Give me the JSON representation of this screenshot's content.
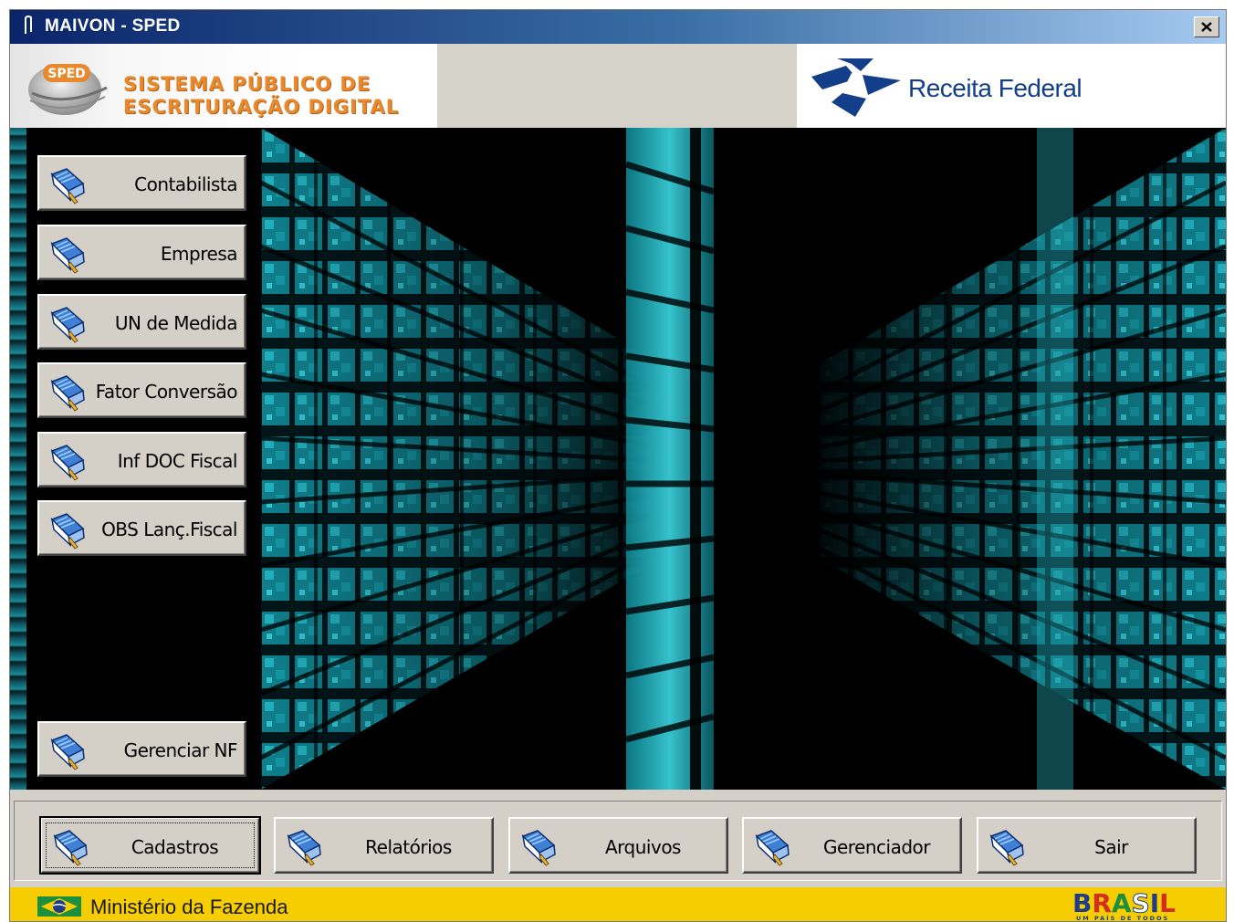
{
  "window": {
    "title": "MAIVON - SPED",
    "close_icon": "close-icon"
  },
  "header": {
    "sped_badge": "SPED",
    "sped_line1": "SISTEMA PÚBLICO DE",
    "sped_line2": "ESCRITURAÇÃO DIGITAL",
    "receita_text": "Receita Federal"
  },
  "sidebar": {
    "items": [
      {
        "label": "Contabilista"
      },
      {
        "label": "Empresa"
      },
      {
        "label": "UN de Medida"
      },
      {
        "label": "Fator Conversão"
      },
      {
        "label": "Inf DOC Fiscal"
      },
      {
        "label": "OBS Lanç.Fiscal"
      }
    ],
    "bottom_item": {
      "label": "Gerenciar  NF"
    }
  },
  "toolbar": {
    "buttons": [
      {
        "label": "Cadastros",
        "focused": true
      },
      {
        "label": "Relatórios"
      },
      {
        "label": "Arquivos"
      },
      {
        "label": "Gerenciador"
      },
      {
        "label": "Sair"
      }
    ]
  },
  "status": {
    "ministry": "Ministério da Fazenda",
    "brasil_logo": "BRASIL",
    "brasil_tagline": "UM PAÍS DE TODOS"
  },
  "colors": {
    "titlebar": "#0a246a",
    "status": "#f6cd00",
    "accent": "#e8892e",
    "cyan": "#19c9d8"
  }
}
